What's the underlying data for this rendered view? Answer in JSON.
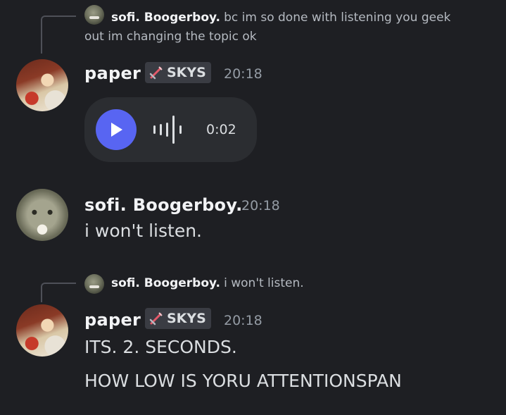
{
  "messages": [
    {
      "reply": {
        "author": "sofi. Boogerboy.",
        "text_line1": "bc im so done with listening you geek",
        "text_line2": "out im changing the topic ok"
      },
      "author": "paper",
      "tag": {
        "icon": "sword-icon",
        "label": "SKYS"
      },
      "time": "20:18",
      "voice": {
        "duration": "0:02"
      }
    },
    {
      "author": "sofi. Boogerboy.",
      "time": "20:18",
      "text": "i won't listen."
    },
    {
      "reply": {
        "author": "sofi. Boogerboy.",
        "text": "i won't listen."
      },
      "author": "paper",
      "tag": {
        "icon": "sword-icon",
        "label": "SKYS"
      },
      "time": "20:18",
      "lines": [
        "ITS. 2. SECONDS.",
        "HOW LOW IS YORU ATTENTIONSPAN"
      ]
    }
  ],
  "colors": {
    "accent": "#5865f2",
    "background": "#1e1f23",
    "tag_bg": "#3a3c43",
    "sword": "#e45a6a"
  }
}
